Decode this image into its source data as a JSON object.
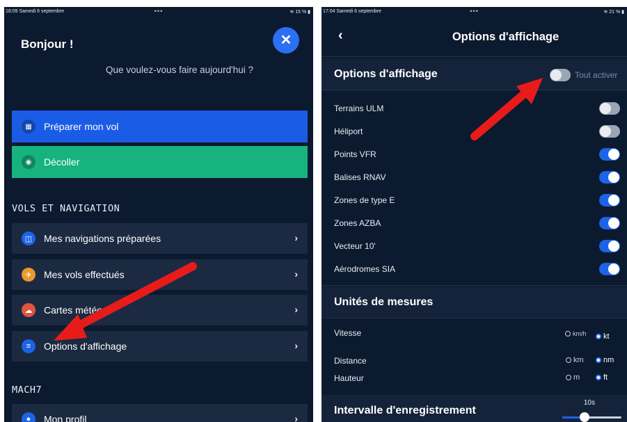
{
  "left": {
    "status": {
      "time": "18:09  Samedi 6 septembre",
      "dots": "•••",
      "battery": "≋ 15 % ▮"
    },
    "greeting": "Bonjour !",
    "close_icon": "✕",
    "subtitle": "Que voulez-vous faire aujourd'hui ?",
    "actions": [
      {
        "label": "Préparer mon vol",
        "icon": "map-board-icon",
        "glyph": "▦"
      },
      {
        "label": "Décoller",
        "icon": "radar-icon",
        "glyph": "◉"
      }
    ],
    "section_vols": "VOLS ET NAVIGATION",
    "menu": [
      {
        "label": "Mes navigations préparées",
        "icon": "map-icon",
        "glyph": "◫",
        "color": "#1d63e8"
      },
      {
        "label": "Mes vols effectués",
        "icon": "plane-icon",
        "glyph": "✈",
        "color": "#e89a2c"
      },
      {
        "label": "Cartes météo",
        "icon": "cloud-icon",
        "glyph": "☁",
        "color": "#e0553d"
      },
      {
        "label": "Options d'affichage",
        "icon": "sliders-icon",
        "glyph": "≡",
        "color": "#1d63e8"
      }
    ],
    "section_mach": "MACH7",
    "profile": {
      "label": "Mon profil",
      "icon": "user-icon",
      "glyph": "●",
      "color": "#1d63e8"
    },
    "chevron": "›"
  },
  "right": {
    "status": {
      "time": "17:04  Samedi 6 septembre",
      "dots": "•••",
      "battery": "≋ 21 % ▮"
    },
    "back": "‹",
    "title": "Options d'affichage",
    "display_group": "Options d'affichage",
    "toggle_all": {
      "label": "Tout activer",
      "on": false
    },
    "options": [
      {
        "label": "Terrains ULM",
        "on": false
      },
      {
        "label": "Héliport",
        "on": false
      },
      {
        "label": "Points VFR",
        "on": true
      },
      {
        "label": "Balises RNAV",
        "on": true
      },
      {
        "label": "Zones de type E",
        "on": true
      },
      {
        "label": "Zones AZBA",
        "on": true
      },
      {
        "label": "Vecteur 10'",
        "on": true
      },
      {
        "label": "Aérodromes SIA",
        "on": true
      }
    ],
    "units_group": "Unités de mesures",
    "units": [
      {
        "label": "Vitesse",
        "opt1": "km/h",
        "opt2": "kt",
        "selected": "kt"
      },
      {
        "label": "Distance",
        "opt1": "km",
        "opt2": "nm",
        "selected": "nm"
      },
      {
        "label": "Hauteur",
        "opt1": "m",
        "opt2": "ft",
        "selected": "ft"
      }
    ],
    "interval_group": "Intervalle d'enregistrement",
    "interval": {
      "value_label": "10s",
      "fraction": 0.38
    }
  },
  "colors": {
    "bg": "#0c1a2f",
    "primary": "#1b5ce6",
    "green": "#17b37f",
    "arrow": "#e81b1b"
  }
}
